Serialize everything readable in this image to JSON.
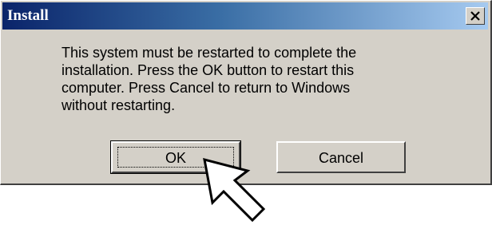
{
  "dialog": {
    "title": "Install",
    "message_lines": [
      "This system must be restarted to complete the",
      "installation. Press the OK button to restart this",
      "computer. Press Cancel to return to Windows",
      "without restarting."
    ],
    "ok_label": "OK",
    "cancel_label": "Cancel"
  },
  "icons": {
    "close": "close-icon",
    "cursor": "arrow-cursor-icon"
  },
  "colors": {
    "dialog_face": "#d4d0c8",
    "titlebar_start": "#0a246a",
    "titlebar_end": "#a6caf0",
    "title_text": "#ffffff"
  }
}
